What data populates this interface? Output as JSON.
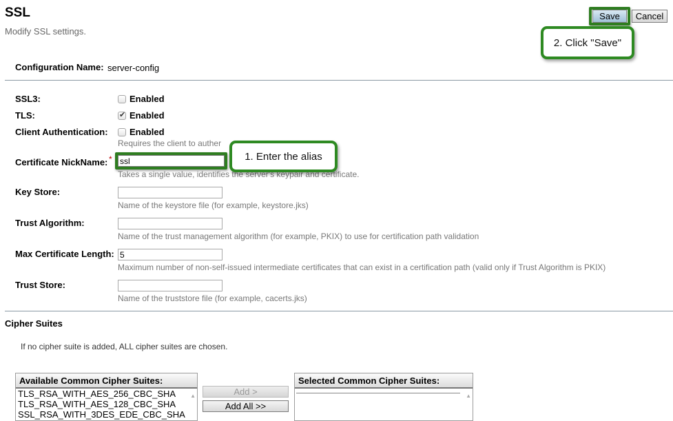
{
  "header": {
    "title": "SSL",
    "help": "Modify SSL settings.",
    "save_label": "Save",
    "cancel_label": "Cancel"
  },
  "annotations": {
    "save_callout": "2. Click \"Save\"",
    "alias_callout": "1. Enter the alias",
    "accent_color": "#2e7d20"
  },
  "config": {
    "label": "Configuration Name:",
    "value": "server-config"
  },
  "form": {
    "ssl3": {
      "label": "SSL3:",
      "option": "Enabled",
      "checked": false
    },
    "tls": {
      "label": "TLS:",
      "option": "Enabled",
      "checked": true
    },
    "client_auth": {
      "label": "Client Authentication:",
      "option": "Enabled",
      "checked": false,
      "help": "Requires the client to auther"
    },
    "cert_nickname": {
      "label": "Certificate NickName:",
      "required_marker": "*",
      "value": "ssl",
      "help": "Takes a single value, identifies the server's keypair and certificate."
    },
    "key_store": {
      "label": "Key Store:",
      "value": "",
      "help": "Name of the keystore file (for example, keystore.jks)"
    },
    "trust_algorithm": {
      "label": "Trust Algorithm:",
      "value": "",
      "help": "Name of the trust management algorithm (for example, PKIX) to use for certification path validation"
    },
    "max_cert_length": {
      "label": "Max Certificate Length:",
      "value": "5",
      "help": "Maximum number of non-self-issued intermediate certificates that can exist in a certification path (valid only if Trust Algorithm is PKIX)"
    },
    "trust_store": {
      "label": "Trust Store:",
      "value": "",
      "help": "Name of the truststore file (for example, cacerts.jks)"
    }
  },
  "cipher": {
    "title": "Cipher Suites",
    "help": "If no cipher suite is added, ALL cipher suites are chosen.",
    "available_header": "Available Common Cipher Suites:",
    "available_items": [
      "TLS_RSA_WITH_AES_256_CBC_SHA",
      "TLS_RSA_WITH_AES_128_CBC_SHA",
      "SSL_RSA_WITH_3DES_EDE_CBC_SHA"
    ],
    "selected_header": "Selected Common Cipher Suites:",
    "add_label": "Add >",
    "add_all_label": "Add All >>"
  }
}
